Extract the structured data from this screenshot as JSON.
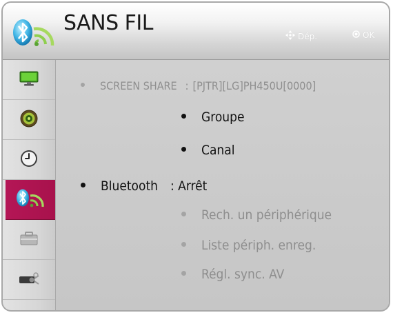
{
  "header": {
    "title": "SANS FIL",
    "icon": "bluetooth-wireless-icon",
    "hint_move": "Dép.",
    "hint_ok": "OK"
  },
  "sidebar": {
    "items": [
      {
        "icon": "picture-monitor-icon",
        "active": false
      },
      {
        "icon": "speaker-audio-icon",
        "active": false
      },
      {
        "icon": "clock-time-icon",
        "active": false
      },
      {
        "icon": "bluetooth-wireless-icon",
        "active": true
      },
      {
        "icon": "option-toolbox-icon",
        "active": false
      },
      {
        "icon": "projector-icon",
        "active": false
      }
    ],
    "active_color": "#b0154f"
  },
  "menu": {
    "screen_share": {
      "label": "SCREEN SHARE",
      "value": "[PJTR][LG]PH450U[0000]"
    },
    "groupe": "Groupe",
    "canal": "Canal",
    "bluetooth": {
      "label": "Bluetooth",
      "value": ": Arrêt"
    },
    "rech": "Rech. un périphérique",
    "liste": "Liste périph. enreg.",
    "regl": "Régl. sync. AV"
  }
}
